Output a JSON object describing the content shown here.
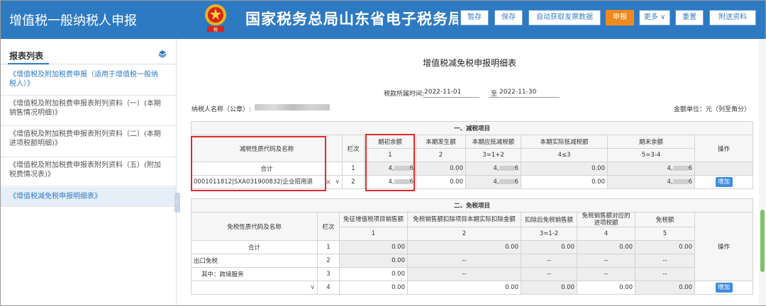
{
  "header": {
    "app_title": "增值税一般纳税人申报",
    "bureau_title": "国家税务总局山东省电子税务局",
    "buttons": {
      "save_draft": "暂存",
      "save": "保存",
      "auto_invoice": "自动获取发票数据",
      "declare": "申报",
      "more": "更多",
      "reset": "重置",
      "attach": "附送资料"
    }
  },
  "sidebar": {
    "title": "报表列表",
    "items": [
      {
        "label": "《增值税及附加税费申报（适用于增值税一般纳税人）》"
      },
      {
        "label": "《增值税及附加税费申报表附列资料（一）(本期销售情况明细)》"
      },
      {
        "label": "《增值税及附加税费申报表附列资料（二）(本期进项税额明细)》"
      },
      {
        "label": "《增值税及附加税费申报表附列资料（五）(附加税费情况表)》"
      },
      {
        "label": "《增值税减免税申报明细表》"
      }
    ]
  },
  "main": {
    "title": "增值税减免税申报明细表",
    "period_label": "税款所属时间:",
    "period_start": "2022-11-01",
    "period_to": "至",
    "period_end": "2022-11-30",
    "taxpayer_label": "纳税人名称（公章）:",
    "unit": "金额单位：元（列至角分）"
  },
  "reduction": {
    "section_title": "一、减税项目",
    "headers": {
      "code": "减税性质代码及名称",
      "row": "栏次",
      "c1": "期初余额",
      "c2": "本期发生额",
      "c3": "本期应抵减税额",
      "c4": "本期实际抵减税额",
      "c5": "期末余额",
      "op": "操作"
    },
    "formulas": {
      "c1": "1",
      "c2": "2",
      "c3": "3=1+2",
      "c4": "4≤3",
      "c5": "5=3-4"
    },
    "total_row": {
      "name": "合计",
      "row": "1",
      "c1": "4,",
      "c1_end": "6",
      "c2": "0.00",
      "c3": "4,",
      "c3_end": "6",
      "c4": "0.00",
      "c5": "4,",
      "c5_end": "6"
    },
    "data_row": {
      "name": "0001011812|SXA031900832|企业招用退",
      "row": "2",
      "c1": "4,",
      "c1_end": "6",
      "c2": "0.00",
      "c3": "4,",
      "c3_end": "6",
      "c4": "0.00",
      "c5": "4,",
      "c5_end": "6",
      "op": "增加"
    }
  },
  "exemption": {
    "section_title": "二、免税项目",
    "headers": {
      "code": "免税性质代码及名称",
      "row": "栏次",
      "c1": "免征增值税项目销售额",
      "c2": "免税销售额扣除项目本期实际扣除金额",
      "c3": "扣除后免税销售额",
      "c4": "免税销售额对应的进项税额",
      "c5": "免税额",
      "op": "操作"
    },
    "formulas": {
      "c1": "1",
      "c2": "2",
      "c3": "3=1-2",
      "c4": "4",
      "c5": "5"
    },
    "rows": [
      {
        "name": "合计",
        "row": "1",
        "c1": "0.00",
        "c2": "0.00",
        "c3": "0.00",
        "c4": "0.00",
        "c5": "0.00"
      },
      {
        "name": "出口免税",
        "row": "2",
        "c1": "0.00",
        "c2": "--",
        "c3": "--",
        "c4": "--",
        "c5": "--"
      },
      {
        "name": "其中：跨境服务",
        "row": "3",
        "c1": "0.00",
        "c2": "--",
        "c3": "--",
        "c4": "--",
        "c5": "--"
      },
      {
        "name": "",
        "row": "4",
        "c1": "0.00",
        "c2": "0.00",
        "c3": "0.00",
        "c4": "0.00",
        "c5": "0.00",
        "op": "增加"
      }
    ]
  }
}
